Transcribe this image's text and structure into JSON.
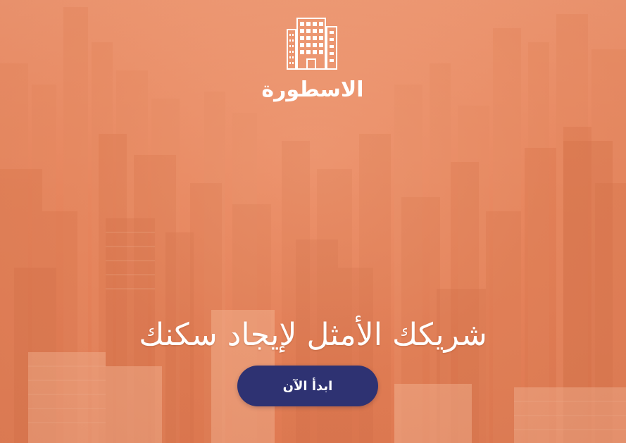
{
  "brand": {
    "name": "الاسطورة",
    "logo_icon": "buildings-icon"
  },
  "hero": {
    "headline": "شريكك الأمثل لإيجاد سكنك",
    "cta_label": "ابدأ الآن"
  },
  "colors": {
    "background_tint": "#e7865e",
    "cta_background": "#2e3272",
    "text": "#ffffff"
  }
}
